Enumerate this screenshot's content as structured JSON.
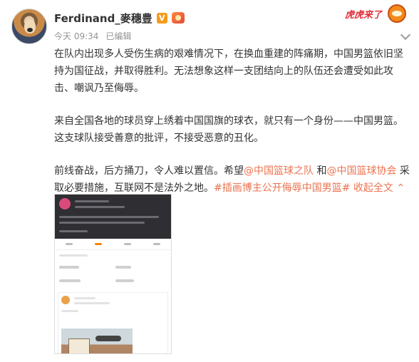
{
  "post": {
    "username": "Ferdinand_麥穗豊",
    "verified_badge": "V",
    "time": "今天 09:34",
    "edited": "已编辑",
    "sticker_text": "虎虎来了",
    "paragraphs": [
      "在队内出现多人受伤生病的艰难情况下，在换血重建的阵痛期，中国男篮依旧坚持为国征战，并取得胜利。无法想象这样一支团结向上的队伍还会遭受如此攻击、嘲讽乃至侮辱。",
      "来自全国各地的球员穿上绣着中国国旗的球衣，就只有一个身份——中国男篮。这支球队接受善意的批评，不接受恶意的丑化。"
    ],
    "p3": {
      "text1": "前线奋战，后方捅刀，令人难以置信。希望",
      "mention1": "@中国篮球之队",
      "text2": " 和",
      "mention2": "@中国篮球协会",
      "text3": " 采取必要措施，互联网不是法外之地。",
      "topic": "#插画博主公开侮辱中国男篮#",
      "expand": "收起全文"
    }
  },
  "icons": {
    "more": "chevron-down-icon",
    "sticker": "tiger-sticker-icon",
    "fan": "fan-badge-icon"
  }
}
